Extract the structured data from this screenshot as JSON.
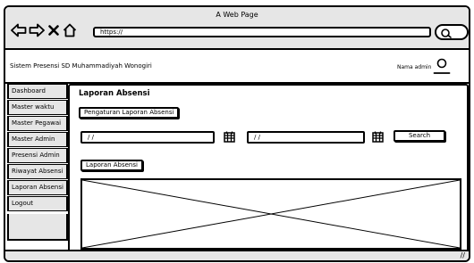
{
  "window": {
    "title": "A Web Page"
  },
  "browser": {
    "url": "https://",
    "back_icon": "back-arrow-icon",
    "forward_icon": "forward-arrow-icon",
    "close_icon": "close-icon",
    "home_icon": "home-icon",
    "search_icon": "search-icon"
  },
  "header": {
    "app_name": "Sistem Presensi SD Muhammadiyah Wonogiri",
    "admin_label": "Nama admin",
    "user_icon": "user-icon"
  },
  "sidebar": {
    "items": [
      {
        "label": "Dashboard"
      },
      {
        "label": "Master waktu"
      },
      {
        "label": "Master Pegawai"
      },
      {
        "label": "Master Admin"
      },
      {
        "label": "Presensi Admin"
      },
      {
        "label": "Riwayat Absensi"
      },
      {
        "label": "Laporan Absensi"
      },
      {
        "label": "Logout"
      }
    ]
  },
  "main": {
    "title": "Laporan Absensi",
    "settings_button": "Pengaturan Laporan Absensi",
    "date_from": "/ /",
    "date_to": "/ /",
    "calendar_icon": "calendar-icon",
    "search_button": "Search",
    "report_button": "Laporan Absensi",
    "placeholder_icon": "image-placeholder-icon"
  },
  "statusbar": {
    "handle": "//"
  }
}
